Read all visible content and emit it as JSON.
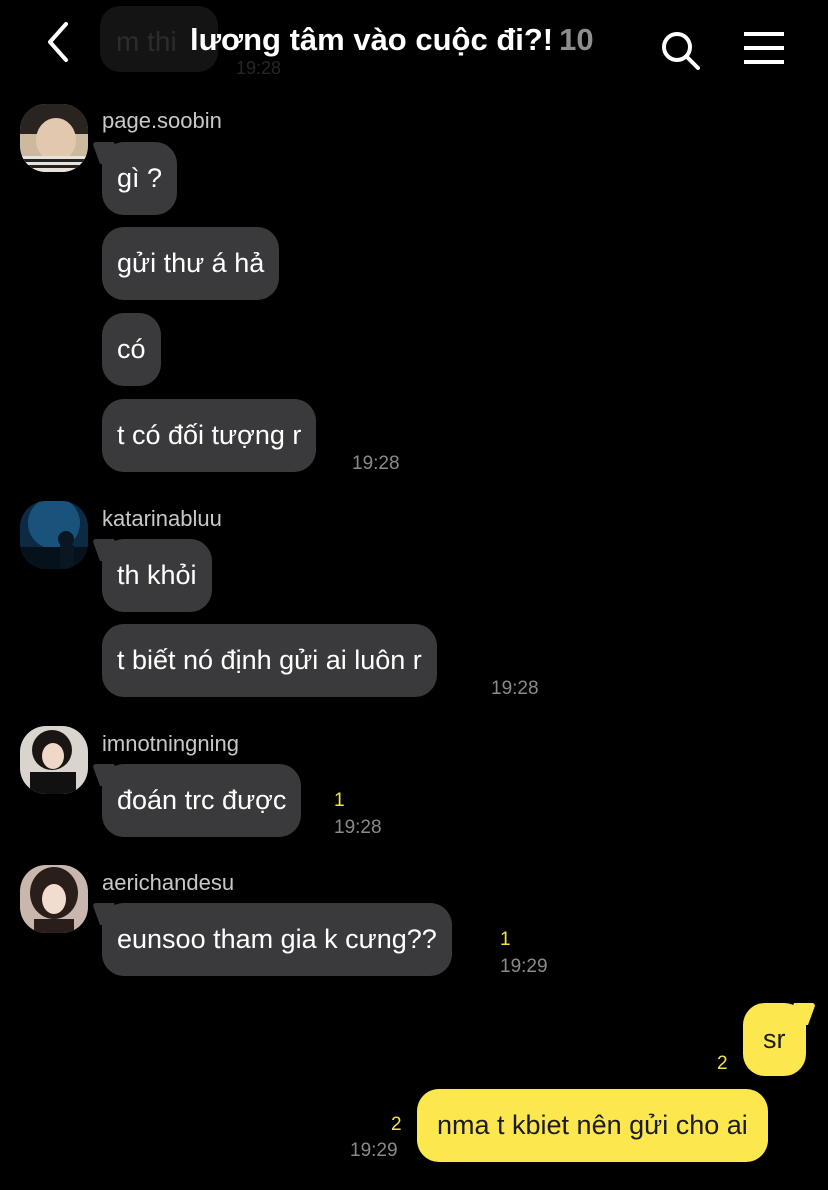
{
  "header": {
    "background_message": "m thi",
    "background_time": "19:28",
    "title": "lương tâm vào cuộc đi?!",
    "member_count": "10"
  },
  "groups": [
    {
      "sender": "page.soobin",
      "messages": [
        "gì ?",
        "gửi thư á hả",
        "có",
        "t có đối tượng r"
      ],
      "time": "19:28"
    },
    {
      "sender": "katarinabluu",
      "messages": [
        "th khỏi",
        "t biết nó định gửi ai luôn r"
      ],
      "time": "19:28"
    },
    {
      "sender": "imnotningning",
      "messages": [
        "đoán trc được"
      ],
      "unread": "1",
      "time": "19:28"
    },
    {
      "sender": "aerichandesu",
      "messages": [
        "eunsoo tham gia k cưng??"
      ],
      "unread": "1",
      "time": "19:29"
    }
  ],
  "mine": {
    "messages": [
      {
        "text": "sr",
        "unread": "2"
      },
      {
        "text": "nma t kbiet nên gửi cho ai",
        "unread": "2",
        "time": "19:29"
      }
    ]
  },
  "colors": {
    "background": "#000000",
    "incoming_bubble": "#3a3a3c",
    "outgoing_bubble": "#fce84e",
    "unread_count": "#f4e44a"
  },
  "icons": [
    "back-icon",
    "search-icon",
    "menu-icon"
  ]
}
